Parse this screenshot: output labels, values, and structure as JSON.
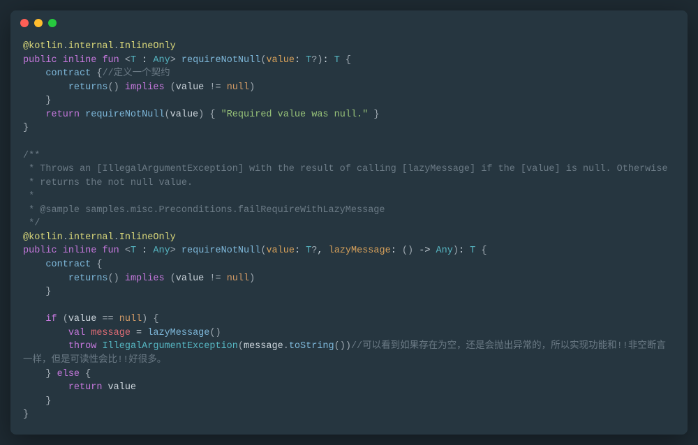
{
  "titlebar": {
    "buttons": [
      "close",
      "minimize",
      "zoom"
    ]
  },
  "code": {
    "tokens": [
      {
        "c": "c-annotation",
        "t": "@kotlin"
      },
      {
        "c": "c-punc",
        "t": "."
      },
      {
        "c": "c-annotation",
        "t": "internal"
      },
      {
        "c": "c-punc",
        "t": "."
      },
      {
        "c": "c-annotation",
        "t": "InlineOnly"
      },
      {
        "c": "",
        "t": "\n"
      },
      {
        "c": "c-keyword",
        "t": "public"
      },
      {
        "c": "",
        "t": " "
      },
      {
        "c": "c-keyword",
        "t": "inline"
      },
      {
        "c": "",
        "t": " "
      },
      {
        "c": "c-keyword",
        "t": "fun"
      },
      {
        "c": "",
        "t": " "
      },
      {
        "c": "c-punc",
        "t": "<"
      },
      {
        "c": "c-type",
        "t": "T"
      },
      {
        "c": "c-normal",
        "t": " : "
      },
      {
        "c": "c-type",
        "t": "Any"
      },
      {
        "c": "c-punc",
        "t": ">"
      },
      {
        "c": "",
        "t": " "
      },
      {
        "c": "c-func",
        "t": "requireNotNull"
      },
      {
        "c": "c-punc",
        "t": "("
      },
      {
        "c": "c-param",
        "t": "value"
      },
      {
        "c": "c-normal",
        "t": ": "
      },
      {
        "c": "c-type",
        "t": "T"
      },
      {
        "c": "c-punc",
        "t": "?"
      },
      {
        "c": "c-punc",
        "t": ")"
      },
      {
        "c": "c-normal",
        "t": ": "
      },
      {
        "c": "c-type",
        "t": "T"
      },
      {
        "c": "",
        "t": " "
      },
      {
        "c": "c-punc",
        "t": "{"
      },
      {
        "c": "",
        "t": "\n"
      },
      {
        "c": "",
        "t": "    "
      },
      {
        "c": "c-func",
        "t": "contract"
      },
      {
        "c": "",
        "t": " "
      },
      {
        "c": "c-punc",
        "t": "{"
      },
      {
        "c": "c-comment",
        "t": "//定义一个契约"
      },
      {
        "c": "",
        "t": "\n"
      },
      {
        "c": "",
        "t": "        "
      },
      {
        "c": "c-func",
        "t": "returns"
      },
      {
        "c": "c-punc",
        "t": "()"
      },
      {
        "c": "",
        "t": " "
      },
      {
        "c": "c-keyword",
        "t": "implies"
      },
      {
        "c": "",
        "t": " "
      },
      {
        "c": "c-punc",
        "t": "("
      },
      {
        "c": "c-normal",
        "t": "value "
      },
      {
        "c": "c-punc",
        "t": "!="
      },
      {
        "c": "",
        "t": " "
      },
      {
        "c": "c-null",
        "t": "null"
      },
      {
        "c": "c-punc",
        "t": ")"
      },
      {
        "c": "",
        "t": "\n"
      },
      {
        "c": "",
        "t": "    "
      },
      {
        "c": "c-punc",
        "t": "}"
      },
      {
        "c": "",
        "t": "\n"
      },
      {
        "c": "",
        "t": "    "
      },
      {
        "c": "c-keyword",
        "t": "return"
      },
      {
        "c": "",
        "t": " "
      },
      {
        "c": "c-func",
        "t": "requireNotNull"
      },
      {
        "c": "c-punc",
        "t": "("
      },
      {
        "c": "c-normal",
        "t": "value"
      },
      {
        "c": "c-punc",
        "t": ")"
      },
      {
        "c": "",
        "t": " "
      },
      {
        "c": "c-punc",
        "t": "{"
      },
      {
        "c": "",
        "t": " "
      },
      {
        "c": "c-string",
        "t": "\"Required value was null.\""
      },
      {
        "c": "",
        "t": " "
      },
      {
        "c": "c-punc",
        "t": "}"
      },
      {
        "c": "",
        "t": "\n"
      },
      {
        "c": "c-punc",
        "t": "}"
      },
      {
        "c": "",
        "t": "\n"
      },
      {
        "c": "",
        "t": "\n"
      },
      {
        "c": "c-comment",
        "t": "/**"
      },
      {
        "c": "",
        "t": "\n"
      },
      {
        "c": "c-comment",
        "t": " * Throws an [IllegalArgumentException] with the result of calling [lazyMessage] if the [value] is null. Otherwise"
      },
      {
        "c": "",
        "t": "\n"
      },
      {
        "c": "c-comment",
        "t": " * returns the not null value."
      },
      {
        "c": "",
        "t": "\n"
      },
      {
        "c": "c-comment",
        "t": " *"
      },
      {
        "c": "",
        "t": "\n"
      },
      {
        "c": "c-comment",
        "t": " * @sample samples.misc.Preconditions.failRequireWithLazyMessage"
      },
      {
        "c": "",
        "t": "\n"
      },
      {
        "c": "c-comment",
        "t": " */"
      },
      {
        "c": "",
        "t": "\n"
      },
      {
        "c": "c-annotation",
        "t": "@kotlin"
      },
      {
        "c": "c-punc",
        "t": "."
      },
      {
        "c": "c-annotation",
        "t": "internal"
      },
      {
        "c": "c-punc",
        "t": "."
      },
      {
        "c": "c-annotation",
        "t": "InlineOnly"
      },
      {
        "c": "",
        "t": "\n"
      },
      {
        "c": "c-keyword",
        "t": "public"
      },
      {
        "c": "",
        "t": " "
      },
      {
        "c": "c-keyword",
        "t": "inline"
      },
      {
        "c": "",
        "t": " "
      },
      {
        "c": "c-keyword",
        "t": "fun"
      },
      {
        "c": "",
        "t": " "
      },
      {
        "c": "c-punc",
        "t": "<"
      },
      {
        "c": "c-type",
        "t": "T"
      },
      {
        "c": "c-normal",
        "t": " : "
      },
      {
        "c": "c-type",
        "t": "Any"
      },
      {
        "c": "c-punc",
        "t": ">"
      },
      {
        "c": "",
        "t": " "
      },
      {
        "c": "c-func",
        "t": "requireNotNull"
      },
      {
        "c": "c-punc",
        "t": "("
      },
      {
        "c": "c-param",
        "t": "value"
      },
      {
        "c": "c-normal",
        "t": ": "
      },
      {
        "c": "c-type",
        "t": "T"
      },
      {
        "c": "c-punc",
        "t": "?"
      },
      {
        "c": "c-normal",
        "t": ", "
      },
      {
        "c": "c-param",
        "t": "lazyMessage"
      },
      {
        "c": "c-normal",
        "t": ": "
      },
      {
        "c": "c-punc",
        "t": "()"
      },
      {
        "c": "c-normal",
        "t": " -> "
      },
      {
        "c": "c-type",
        "t": "Any"
      },
      {
        "c": "c-punc",
        "t": ")"
      },
      {
        "c": "c-normal",
        "t": ": "
      },
      {
        "c": "c-type",
        "t": "T"
      },
      {
        "c": "",
        "t": " "
      },
      {
        "c": "c-punc",
        "t": "{"
      },
      {
        "c": "",
        "t": "\n"
      },
      {
        "c": "",
        "t": "    "
      },
      {
        "c": "c-func",
        "t": "contract"
      },
      {
        "c": "",
        "t": " "
      },
      {
        "c": "c-punc",
        "t": "{"
      },
      {
        "c": "",
        "t": "\n"
      },
      {
        "c": "",
        "t": "        "
      },
      {
        "c": "c-func",
        "t": "returns"
      },
      {
        "c": "c-punc",
        "t": "()"
      },
      {
        "c": "",
        "t": " "
      },
      {
        "c": "c-keyword",
        "t": "implies"
      },
      {
        "c": "",
        "t": " "
      },
      {
        "c": "c-punc",
        "t": "("
      },
      {
        "c": "c-normal",
        "t": "value "
      },
      {
        "c": "c-punc",
        "t": "!="
      },
      {
        "c": "",
        "t": " "
      },
      {
        "c": "c-null",
        "t": "null"
      },
      {
        "c": "c-punc",
        "t": ")"
      },
      {
        "c": "",
        "t": "\n"
      },
      {
        "c": "",
        "t": "    "
      },
      {
        "c": "c-punc",
        "t": "}"
      },
      {
        "c": "",
        "t": "\n"
      },
      {
        "c": "",
        "t": "\n"
      },
      {
        "c": "",
        "t": "    "
      },
      {
        "c": "c-keyword",
        "t": "if"
      },
      {
        "c": "",
        "t": " "
      },
      {
        "c": "c-punc",
        "t": "("
      },
      {
        "c": "c-normal",
        "t": "value "
      },
      {
        "c": "c-punc",
        "t": "=="
      },
      {
        "c": "",
        "t": " "
      },
      {
        "c": "c-null",
        "t": "null"
      },
      {
        "c": "c-punc",
        "t": ")"
      },
      {
        "c": "",
        "t": " "
      },
      {
        "c": "c-punc",
        "t": "{"
      },
      {
        "c": "",
        "t": "\n"
      },
      {
        "c": "",
        "t": "        "
      },
      {
        "c": "c-keyword",
        "t": "val"
      },
      {
        "c": "",
        "t": " "
      },
      {
        "c": "c-ident",
        "t": "message"
      },
      {
        "c": "c-normal",
        "t": " = "
      },
      {
        "c": "c-func",
        "t": "lazyMessage"
      },
      {
        "c": "c-punc",
        "t": "()"
      },
      {
        "c": "",
        "t": "\n"
      },
      {
        "c": "",
        "t": "        "
      },
      {
        "c": "c-keyword",
        "t": "throw"
      },
      {
        "c": "",
        "t": " "
      },
      {
        "c": "c-type",
        "t": "IllegalArgumentException"
      },
      {
        "c": "c-punc",
        "t": "("
      },
      {
        "c": "c-normal",
        "t": "message"
      },
      {
        "c": "c-punc",
        "t": "."
      },
      {
        "c": "c-func",
        "t": "toString"
      },
      {
        "c": "c-punc",
        "t": "())"
      },
      {
        "c": "c-comment",
        "t": "//可以看到如果存在为空，还是会抛出异常的，所以实现功能和!!非空断言一样，但是可读性会比!!好很多。"
      },
      {
        "c": "",
        "t": "\n"
      },
      {
        "c": "",
        "t": "    "
      },
      {
        "c": "c-punc",
        "t": "}"
      },
      {
        "c": "",
        "t": " "
      },
      {
        "c": "c-keyword",
        "t": "else"
      },
      {
        "c": "",
        "t": " "
      },
      {
        "c": "c-punc",
        "t": "{"
      },
      {
        "c": "",
        "t": "\n"
      },
      {
        "c": "",
        "t": "        "
      },
      {
        "c": "c-keyword",
        "t": "return"
      },
      {
        "c": "",
        "t": " "
      },
      {
        "c": "c-normal",
        "t": "value"
      },
      {
        "c": "",
        "t": "\n"
      },
      {
        "c": "",
        "t": "    "
      },
      {
        "c": "c-punc",
        "t": "}"
      },
      {
        "c": "",
        "t": "\n"
      },
      {
        "c": "c-punc",
        "t": "}"
      }
    ]
  }
}
